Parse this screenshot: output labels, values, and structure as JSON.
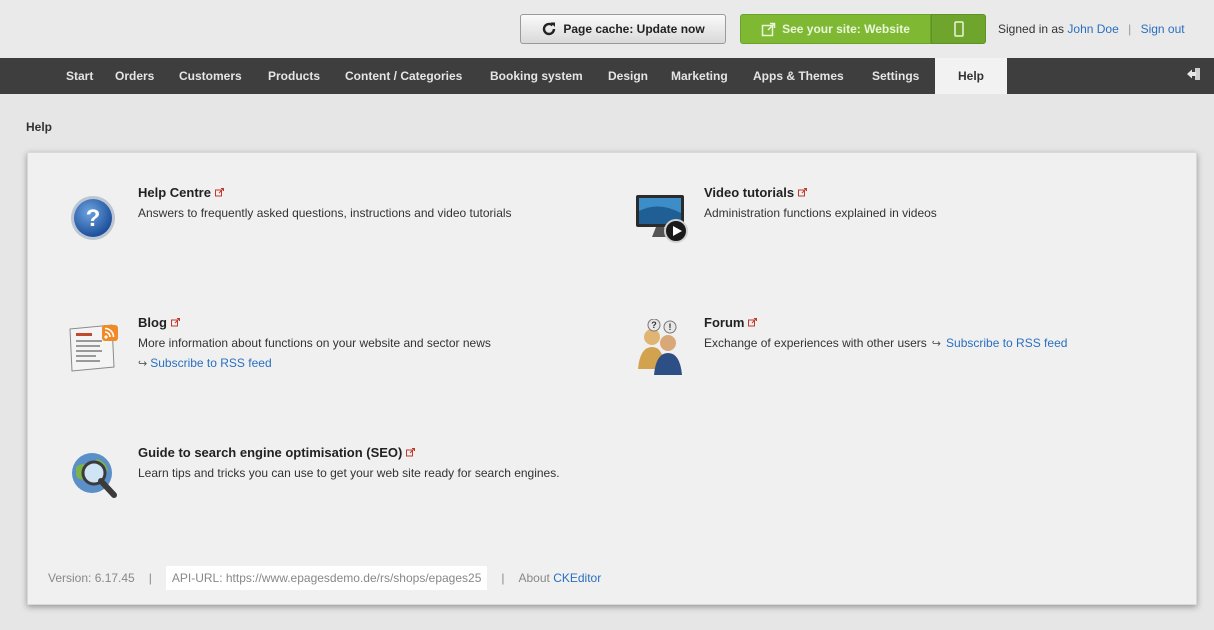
{
  "topbar": {
    "cache_button": "Page cache: Update now",
    "site_button": "See your site: Website",
    "signed_prefix": "Signed in as",
    "user_name": "John Doe",
    "sign_out": "Sign out"
  },
  "nav": {
    "items": [
      "Start",
      "Orders",
      "Customers",
      "Products",
      "Content / Categories",
      "Booking system",
      "Design",
      "Marketing",
      "Apps & Themes",
      "Settings",
      "Help"
    ],
    "active": "Help"
  },
  "breadcrumb": "Help",
  "help": {
    "help_centre": {
      "title": "Help Centre",
      "desc": "Answers to frequently asked questions, instructions and video tutorials"
    },
    "video": {
      "title": "Video tutorials",
      "desc": "Administration functions explained in videos"
    },
    "blog": {
      "title": "Blog",
      "desc": "More information about functions on your website and sector news",
      "rss": "Subscribe to RSS feed"
    },
    "forum": {
      "title": "Forum",
      "desc": "Exchange of experiences with other users",
      "rss": "Subscribe to RSS feed"
    },
    "seo": {
      "title": "Guide to search engine optimisation (SEO)",
      "desc": "Learn tips and tricks you can use to get your web site ready for search engines."
    }
  },
  "footer": {
    "version": "Version: 6.17.45",
    "api_url": "API-URL: https://www.epagesdemo.de/rs/shops/epages25",
    "about_prefix": "About",
    "about_link": "CKEditor"
  },
  "colors": {
    "accent_green": "#7fb934",
    "link": "#2a6fbf",
    "nav_bg": "#3e3e3e"
  }
}
